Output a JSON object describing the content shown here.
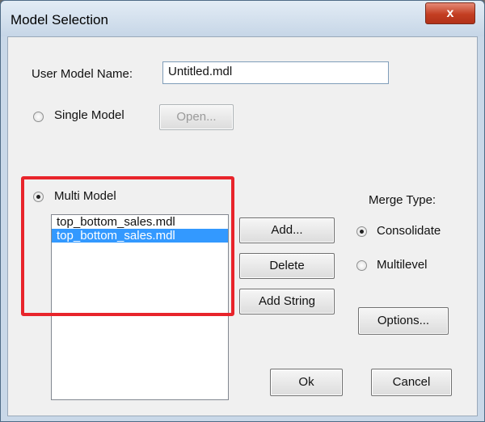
{
  "window": {
    "title": "Model Selection",
    "close_label": "x"
  },
  "user_model_name": {
    "label": "User Model Name:",
    "value": "Untitled.mdl"
  },
  "single_model": {
    "label": "Single Model",
    "checked": false,
    "open_button": "Open..."
  },
  "multi_model": {
    "label": "Multi Model",
    "checked": true,
    "files": [
      {
        "name": "top_bottom_sales.mdl",
        "selected": false
      },
      {
        "name": "top_bottom_sales.mdl",
        "selected": true
      }
    ],
    "buttons": {
      "add": "Add...",
      "delete": "Delete",
      "add_string": "Add String"
    }
  },
  "merge_type": {
    "label": "Merge Type:",
    "options": [
      {
        "label": "Consolidate",
        "checked": true
      },
      {
        "label": "Multilevel",
        "checked": false
      }
    ]
  },
  "buttons": {
    "options": "Options...",
    "ok": "Ok",
    "cancel": "Cancel"
  },
  "annotation": {
    "color": "#e8242b"
  }
}
